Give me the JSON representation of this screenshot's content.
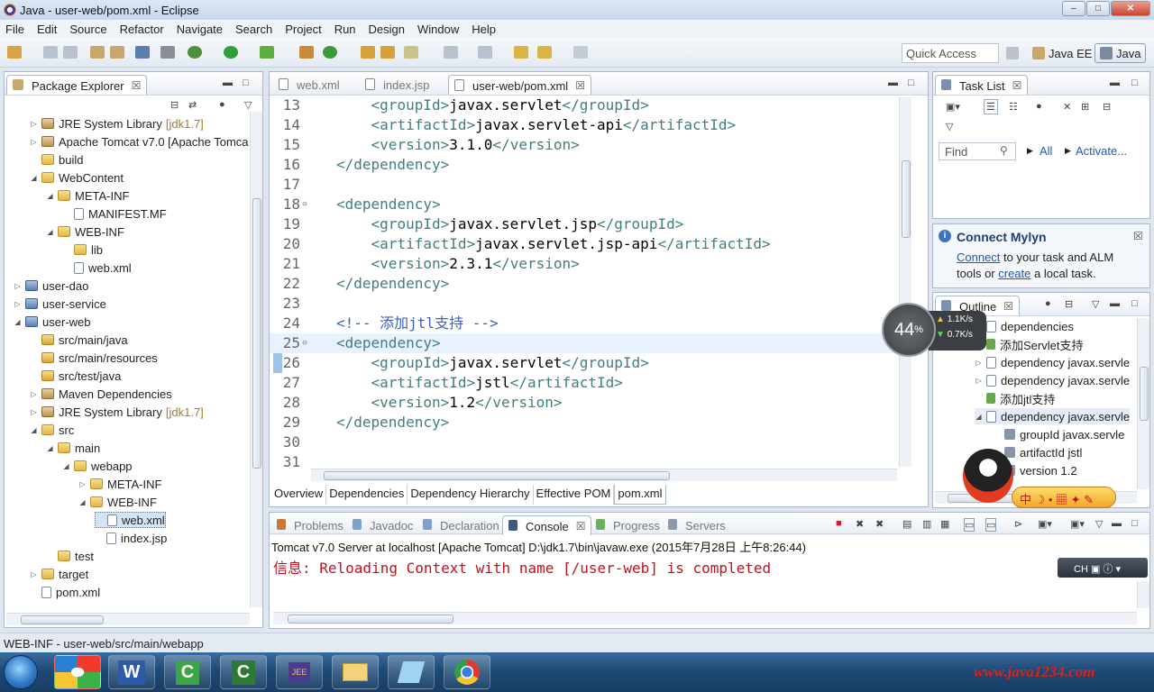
{
  "window": {
    "title": "Java - user-web/pom.xml - Eclipse",
    "minimize": "–",
    "maximize": "□",
    "close": "✕"
  },
  "menu": [
    "File",
    "Edit",
    "Source",
    "Refactor",
    "Navigate",
    "Search",
    "Project",
    "Run",
    "Design",
    "Window",
    "Help"
  ],
  "toolbar": {
    "quick_access_placeholder": "Quick Access",
    "perspectives": [
      {
        "label": "Java EE",
        "active": false
      },
      {
        "label": "Java",
        "active": true
      }
    ]
  },
  "package_explorer": {
    "tab_label": "Package Explorer",
    "rows": [
      {
        "label": "JRE System Library",
        "suffix": "[jdk1.7]",
        "type": "lib",
        "twisty": "▷",
        "indent": 1
      },
      {
        "label": "Apache Tomcat v7.0 [Apache Tomca",
        "suffix": "",
        "type": "lib",
        "twisty": "▷",
        "indent": 1
      },
      {
        "label": "build",
        "suffix": "",
        "type": "folder",
        "twisty": "",
        "indent": 1
      },
      {
        "label": "WebContent",
        "suffix": "",
        "type": "folder",
        "twisty": "◢",
        "indent": 1
      },
      {
        "label": "META-INF",
        "suffix": "",
        "type": "folder",
        "twisty": "◢",
        "indent": 2
      },
      {
        "label": "MANIFEST.MF",
        "suffix": "",
        "type": "file",
        "twisty": "",
        "indent": 3
      },
      {
        "label": "WEB-INF",
        "suffix": "",
        "type": "folder",
        "twisty": "◢",
        "indent": 2
      },
      {
        "label": "lib",
        "suffix": "",
        "type": "folder",
        "twisty": "",
        "indent": 3
      },
      {
        "label": "web.xml",
        "suffix": "",
        "type": "file",
        "twisty": "",
        "indent": 3
      },
      {
        "label": "user-dao",
        "suffix": "",
        "type": "proj",
        "twisty": "▷",
        "indent": 0
      },
      {
        "label": "user-service",
        "suffix": "",
        "type": "proj",
        "twisty": "▷",
        "indent": 0
      },
      {
        "label": "user-web",
        "suffix": "",
        "type": "proj",
        "twisty": "◢",
        "indent": 0
      },
      {
        "label": "src/main/java",
        "suffix": "",
        "type": "pkgf",
        "twisty": "",
        "indent": 1
      },
      {
        "label": "src/main/resources",
        "suffix": "",
        "type": "pkgf",
        "twisty": "",
        "indent": 1
      },
      {
        "label": "src/test/java",
        "suffix": "",
        "type": "pkgf",
        "twisty": "",
        "indent": 1
      },
      {
        "label": "Maven Dependencies",
        "suffix": "",
        "type": "lib",
        "twisty": "▷",
        "indent": 1
      },
      {
        "label": "JRE System Library",
        "suffix": "[jdk1.7]",
        "type": "lib",
        "twisty": "▷",
        "indent": 1
      },
      {
        "label": "src",
        "suffix": "",
        "type": "folder",
        "twisty": "◢",
        "indent": 1
      },
      {
        "label": "main",
        "suffix": "",
        "type": "folder",
        "twisty": "◢",
        "indent": 2
      },
      {
        "label": "webapp",
        "suffix": "",
        "type": "folder",
        "twisty": "◢",
        "indent": 3
      },
      {
        "label": "META-INF",
        "suffix": "",
        "type": "folder",
        "twisty": "▷",
        "indent": 4
      },
      {
        "label": "WEB-INF",
        "suffix": "",
        "type": "folder",
        "twisty": "◢",
        "indent": 4
      },
      {
        "label": "web.xml",
        "suffix": "",
        "type": "file",
        "twisty": "",
        "indent": 5
      },
      {
        "label": "index.jsp",
        "suffix": "",
        "type": "file",
        "twisty": "",
        "indent": 5
      },
      {
        "label": "test",
        "suffix": "",
        "type": "folder",
        "twisty": "",
        "indent": 2
      },
      {
        "label": "target",
        "suffix": "",
        "type": "folder",
        "twisty": "▷",
        "indent": 1
      },
      {
        "label": "pom.xml",
        "suffix": "",
        "type": "file",
        "twisty": "",
        "indent": 1
      }
    ]
  },
  "editor": {
    "tabs": [
      {
        "label": "web.xml",
        "active": false
      },
      {
        "label": "index.jsp",
        "active": false
      },
      {
        "label": "user-web/pom.xml",
        "active": true
      }
    ],
    "lines": [
      {
        "n": "13",
        "indent": "    ",
        "kind": "elem",
        "tag": "groupId",
        "value": "javax.servlet",
        "fold": ""
      },
      {
        "n": "14",
        "indent": "    ",
        "kind": "elem",
        "tag": "artifactId",
        "value": "javax.servlet-api",
        "fold": ""
      },
      {
        "n": "15",
        "indent": "    ",
        "kind": "elem",
        "tag": "version",
        "value": "3.1.0",
        "fold": ""
      },
      {
        "n": "16",
        "indent": "",
        "kind": "close",
        "tag": "dependency",
        "value": "",
        "fold": ""
      },
      {
        "n": "17",
        "indent": "",
        "kind": "blank",
        "tag": "",
        "value": "",
        "fold": ""
      },
      {
        "n": "18",
        "indent": "",
        "kind": "open",
        "tag": "dependency",
        "value": "",
        "fold": "⊖"
      },
      {
        "n": "19",
        "indent": "    ",
        "kind": "elem",
        "tag": "groupId",
        "value": "javax.servlet.jsp",
        "fold": ""
      },
      {
        "n": "20",
        "indent": "    ",
        "kind": "elem",
        "tag": "artifactId",
        "value": "javax.servlet.jsp-api",
        "fold": ""
      },
      {
        "n": "21",
        "indent": "    ",
        "kind": "elem",
        "tag": "version",
        "value": "2.3.1",
        "fold": ""
      },
      {
        "n": "22",
        "indent": "",
        "kind": "close",
        "tag": "dependency",
        "value": "",
        "fold": ""
      },
      {
        "n": "23",
        "indent": "",
        "kind": "blank",
        "tag": "",
        "value": "",
        "fold": ""
      },
      {
        "n": "24",
        "indent": "",
        "kind": "comment",
        "tag": "",
        "value": "<!-- 添加jtl支持 -->",
        "fold": ""
      },
      {
        "n": "25",
        "indent": "",
        "kind": "open",
        "tag": "dependency",
        "value": "",
        "fold": "⊖",
        "current": true
      },
      {
        "n": "26",
        "indent": "    ",
        "kind": "elem",
        "tag": "groupId",
        "value": "javax.servlet",
        "fold": ""
      },
      {
        "n": "27",
        "indent": "    ",
        "kind": "elem",
        "tag": "artifactId",
        "value": "jstl",
        "fold": ""
      },
      {
        "n": "28",
        "indent": "    ",
        "kind": "elem",
        "tag": "version",
        "value": "1.2",
        "fold": ""
      },
      {
        "n": "29",
        "indent": "",
        "kind": "close",
        "tag": "dependency",
        "value": "",
        "fold": ""
      },
      {
        "n": "30",
        "indent": "",
        "kind": "blank",
        "tag": "",
        "value": "",
        "fold": ""
      },
      {
        "n": "31",
        "indent": "",
        "kind": "blank",
        "tag": "",
        "value": "",
        "fold": ""
      }
    ],
    "bottom_tabs": [
      {
        "label": "Overview",
        "active": false
      },
      {
        "label": "Dependencies",
        "active": false
      },
      {
        "label": "Dependency Hierarchy",
        "active": false
      },
      {
        "label": "Effective POM",
        "active": false
      },
      {
        "label": "pom.xml",
        "active": true
      }
    ]
  },
  "task_list": {
    "tab_label": "Task List",
    "find_placeholder": "Find",
    "all_label": "All",
    "activate_label": "Activate..."
  },
  "mylyn": {
    "title": "Connect Mylyn",
    "connect_link": "Connect",
    "text1": " to your task and ALM",
    "text2": "tools or ",
    "create_link": "create",
    "text3": " a local task."
  },
  "outline": {
    "tab_label": "Outline",
    "rows": [
      {
        "label": "dependencies",
        "indent": 0,
        "twisty": "",
        "icon": "elem"
      },
      {
        "label": "添加Servlet支持",
        "indent": 0,
        "twisty": "",
        "icon": "comment"
      },
      {
        "label": "dependency  javax.servle",
        "indent": 0,
        "twisty": "▷",
        "icon": "elem"
      },
      {
        "label": "dependency  javax.servle",
        "indent": 0,
        "twisty": "▷",
        "icon": "elem"
      },
      {
        "label": "添加jtl支持",
        "indent": 0,
        "twisty": "",
        "icon": "comment"
      },
      {
        "label": "dependency  javax.servle",
        "indent": 0,
        "twisty": "◢",
        "icon": "elem"
      },
      {
        "label": "groupId  javax.servle",
        "indent": 1,
        "twisty": "",
        "icon": "attr"
      },
      {
        "label": "artifactId  jstl",
        "indent": 1,
        "twisty": "",
        "icon": "attr"
      },
      {
        "label": "version  1.2",
        "indent": 1,
        "twisty": "",
        "icon": "attr"
      }
    ]
  },
  "network_widget": {
    "percent": "44",
    "pct_sign": "%",
    "up": "1.1",
    "down": "0.7",
    "unit": "K/s"
  },
  "console": {
    "tabs": [
      {
        "label": "Problems",
        "active": false
      },
      {
        "label": "Javadoc",
        "active": false
      },
      {
        "label": "Declaration",
        "active": false
      },
      {
        "label": "Console",
        "active": true
      },
      {
        "label": "Progress",
        "active": false
      },
      {
        "label": "Servers",
        "active": false
      }
    ],
    "header": "Tomcat v7.0 Server at localhost [Apache Tomcat] D:\\jdk1.7\\bin\\javaw.exe (2015年7月28日 上午8:26:44)",
    "message": "信息: Reloading Context with name [/user-web] is completed"
  },
  "ime": {
    "lang": "CH",
    "chars": "中"
  },
  "status_bar": {
    "text": "WEB-INF - user-web/src/main/webapp"
  },
  "taskbar_items": [
    "word",
    "camtasia-recorder",
    "camtasia-studio",
    "java-ee",
    "file-explorer",
    "notepad",
    "chrome"
  ],
  "watermark": "www.java1234.com"
}
